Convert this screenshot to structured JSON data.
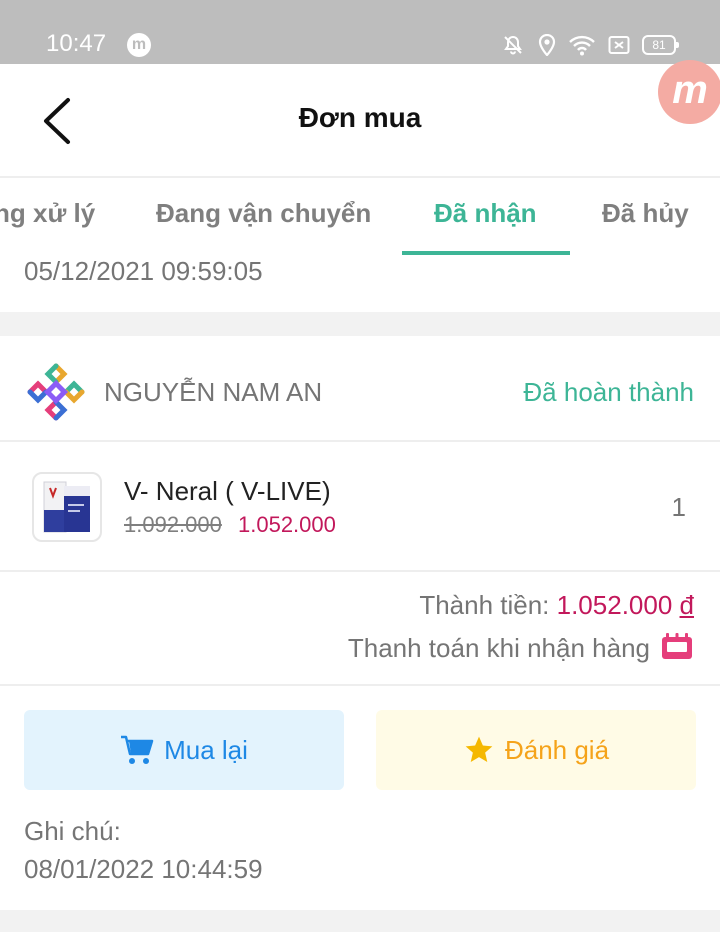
{
  "status_bar": {
    "time": "10:47",
    "app_badge": "m",
    "battery": "81",
    "icons": [
      "mute-icon",
      "location-icon",
      "wifi-icon",
      "nfc-icon",
      "battery-icon"
    ]
  },
  "header": {
    "title": "Đơn mua",
    "floating_badge": "m"
  },
  "tabs": [
    {
      "label": "ng xử lý",
      "active": false
    },
    {
      "label": "Đang vận chuyển",
      "active": false
    },
    {
      "label": "Đã nhận",
      "active": true
    },
    {
      "label": "Đã hủy",
      "active": false
    }
  ],
  "order": {
    "date": "05/12/2021 09:59:05",
    "shop_name": "NGUYỄN NAM AN",
    "status": "Đã hoàn thành",
    "product": {
      "name": "V- Neral ( V-LIVE)",
      "old_price": "1.092.000",
      "new_price": "1.052.000",
      "quantity": "1"
    },
    "total_label": "Thành tiền: ",
    "total_amount": "1.052.000",
    "currency": "đ",
    "payment_method": "Thanh toán khi nhận hàng",
    "note_label": "Ghi chú:",
    "note_date": "08/01/2022 10:44:59"
  },
  "actions": {
    "rebuy_label": "Mua lại",
    "rate_label": "Đánh giá"
  },
  "colors": {
    "accent": "#3db596",
    "price": "#c2185b",
    "rebuy": "#1e88e5",
    "rate": "#f5a31a"
  }
}
